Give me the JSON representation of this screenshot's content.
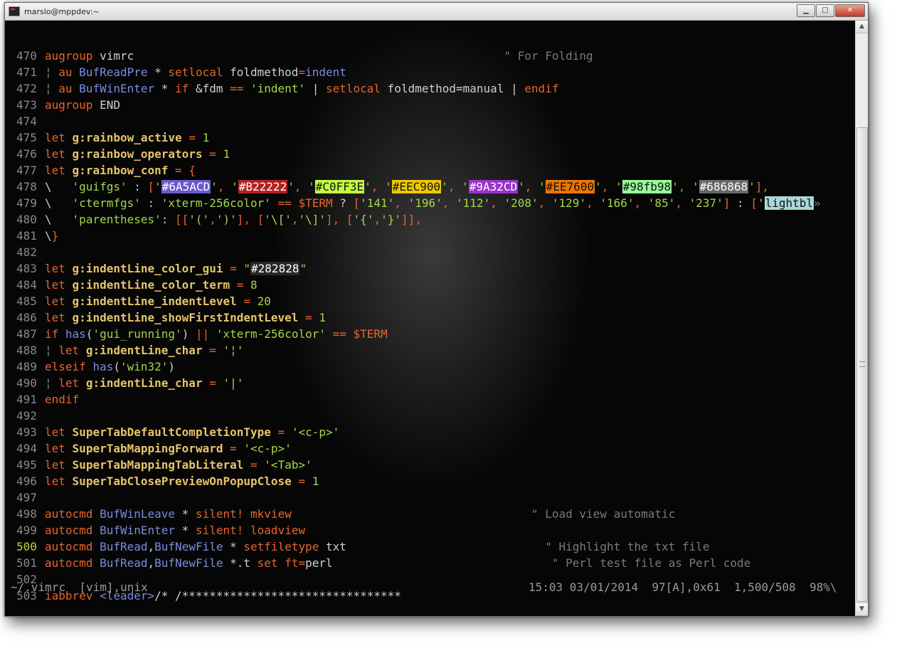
{
  "window": {
    "title": "marslo@mppdev:~"
  },
  "colors": {
    "keyword": "#e8642a",
    "function": "#7c8be0",
    "string": "#a5d64a",
    "variable": "#e6c46a",
    "comment": "#7a7a7a",
    "linenumber": "#8a8a8a",
    "current_linenumber": "#b8d63a"
  },
  "lines": [
    {
      "n": "470",
      "t": [
        [
          "kw",
          "augroup"
        ],
        [
          "id",
          " vimrc"
        ],
        [
          "id",
          "                                                      "
        ],
        [
          "cmt",
          "\" For Folding"
        ]
      ]
    },
    {
      "n": "471",
      "t": [
        [
          "pipe",
          "¦ "
        ],
        [
          "kw",
          "au"
        ],
        [
          "id",
          " "
        ],
        [
          "fn",
          "BufReadPre"
        ],
        [
          "id",
          " * "
        ],
        [
          "kw",
          "setlocal"
        ],
        [
          "id",
          " foldmethod"
        ],
        [
          "op",
          "="
        ],
        [
          "fn",
          "indent"
        ]
      ]
    },
    {
      "n": "472",
      "t": [
        [
          "pipe",
          "¦ "
        ],
        [
          "kw",
          "au"
        ],
        [
          "id",
          " "
        ],
        [
          "fn",
          "BufWinEnter"
        ],
        [
          "id",
          " * "
        ],
        [
          "kw",
          "if"
        ],
        [
          "id",
          " &fdm "
        ],
        [
          "op",
          "=="
        ],
        [
          "id",
          " "
        ],
        [
          "str",
          "'indent'"
        ],
        [
          "id",
          " | "
        ],
        [
          "kw",
          "setlocal"
        ],
        [
          "id",
          " foldmethod=manual | "
        ],
        [
          "kw",
          "endif"
        ]
      ]
    },
    {
      "n": "473",
      "t": [
        [
          "kw",
          "augroup"
        ],
        [
          "id",
          " END"
        ]
      ]
    },
    {
      "n": "474",
      "t": []
    },
    {
      "n": "475",
      "t": [
        [
          "kw",
          "let"
        ],
        [
          "id",
          " "
        ],
        [
          "var",
          "g:rainbow_active"
        ],
        [
          "id",
          " "
        ],
        [
          "op",
          "="
        ],
        [
          "id",
          " "
        ],
        [
          "num",
          "1"
        ]
      ]
    },
    {
      "n": "476",
      "t": [
        [
          "kw",
          "let"
        ],
        [
          "id",
          " "
        ],
        [
          "var",
          "g:rainbow_operators"
        ],
        [
          "id",
          " "
        ],
        [
          "op",
          "="
        ],
        [
          "id",
          " "
        ],
        [
          "num",
          "1"
        ]
      ]
    },
    {
      "n": "477",
      "t": [
        [
          "kw",
          "let"
        ],
        [
          "id",
          " "
        ],
        [
          "var",
          "g:rainbow_conf"
        ],
        [
          "id",
          " "
        ],
        [
          "op",
          "="
        ],
        [
          "id",
          " "
        ],
        [
          "kw",
          "{"
        ]
      ]
    },
    {
      "n": "478",
      "t": [
        [
          "id",
          "\\   "
        ],
        [
          "str",
          "'guifgs'"
        ],
        [
          "id",
          " : "
        ],
        [
          "kw",
          "["
        ],
        [
          "str",
          "'"
        ],
        [
          "chip:#6A5ACD",
          "#6A5ACD"
        ],
        [
          "str",
          "'"
        ],
        [
          "kw",
          ", "
        ],
        [
          "str",
          "'"
        ],
        [
          "chip:#B22222",
          "#B22222"
        ],
        [
          "str",
          "'"
        ],
        [
          "kw",
          ", "
        ],
        [
          "str",
          "'"
        ],
        [
          "chipd:#C0FF3E",
          "#C0FF3E"
        ],
        [
          "str",
          "'"
        ],
        [
          "kw",
          ", "
        ],
        [
          "str",
          "'"
        ],
        [
          "chipd:#EEC900",
          "#EEC900"
        ],
        [
          "str",
          "'"
        ],
        [
          "kw",
          ", "
        ],
        [
          "str",
          "'"
        ],
        [
          "chip:#9A32CD",
          "#9A32CD"
        ],
        [
          "str",
          "'"
        ],
        [
          "kw",
          ", "
        ],
        [
          "str",
          "'"
        ],
        [
          "chipd:#EE7600",
          "#EE7600"
        ],
        [
          "str",
          "'"
        ],
        [
          "kw",
          ", "
        ],
        [
          "str",
          "'"
        ],
        [
          "chipd:#98fb98",
          "#98fb98"
        ],
        [
          "str",
          "'"
        ],
        [
          "kw",
          ", "
        ],
        [
          "str",
          "'"
        ],
        [
          "chip:#686868",
          "#686868"
        ],
        [
          "str",
          "'"
        ],
        [
          "kw",
          "],"
        ]
      ]
    },
    {
      "n": "479",
      "t": [
        [
          "id",
          "\\   "
        ],
        [
          "str",
          "'ctermfgs'"
        ],
        [
          "id",
          " : "
        ],
        [
          "str",
          "'xterm-256color'"
        ],
        [
          "id",
          " "
        ],
        [
          "op",
          "=="
        ],
        [
          "id",
          " "
        ],
        [
          "env",
          "$TERM"
        ],
        [
          "id",
          " ? "
        ],
        [
          "kw",
          "["
        ],
        [
          "str",
          "'141'"
        ],
        [
          "kw",
          ", "
        ],
        [
          "str",
          "'196'"
        ],
        [
          "kw",
          ", "
        ],
        [
          "str",
          "'112'"
        ],
        [
          "kw",
          ", "
        ],
        [
          "str",
          "'208'"
        ],
        [
          "kw",
          ", "
        ],
        [
          "str",
          "'129'"
        ],
        [
          "kw",
          ", "
        ],
        [
          "str",
          "'166'"
        ],
        [
          "kw",
          ", "
        ],
        [
          "str",
          "'85'"
        ],
        [
          "kw",
          ", "
        ],
        [
          "str",
          "'237'"
        ],
        [
          "kw",
          "]"
        ],
        [
          "id",
          " : "
        ],
        [
          "kw",
          "["
        ],
        [
          "str",
          "'"
        ],
        [
          "chipd:#a8d8d8",
          "lightbl"
        ],
        [
          "cmt",
          "»"
        ]
      ]
    },
    {
      "n": "480",
      "t": [
        [
          "id",
          "\\   "
        ],
        [
          "str",
          "'parentheses'"
        ],
        [
          "id",
          ": "
        ],
        [
          "kw",
          "[["
        ],
        [
          "str",
          "'('"
        ],
        [
          "kw",
          ","
        ],
        [
          "str",
          "')'"
        ],
        [
          "kw",
          "]"
        ],
        [
          "kw",
          ", "
        ],
        [
          "kw",
          "["
        ],
        [
          "str",
          "'\\['"
        ],
        [
          "kw",
          ","
        ],
        [
          "str",
          "'\\]'"
        ],
        [
          "kw",
          "]"
        ],
        [
          "kw",
          ", "
        ],
        [
          "kw",
          "["
        ],
        [
          "str",
          "'{'"
        ],
        [
          "kw",
          ","
        ],
        [
          "str",
          "'}'"
        ],
        [
          "kw",
          "]]"
        ],
        [
          "kw",
          ","
        ]
      ]
    },
    {
      "n": "481",
      "t": [
        [
          "id",
          "\\"
        ],
        [
          "kw",
          "}"
        ]
      ]
    },
    {
      "n": "482",
      "t": []
    },
    {
      "n": "483",
      "t": [
        [
          "kw",
          "let"
        ],
        [
          "id",
          " "
        ],
        [
          "var",
          "g:indentLine_color_gui"
        ],
        [
          "id",
          " "
        ],
        [
          "op",
          "="
        ],
        [
          "id",
          " "
        ],
        [
          "str",
          "\""
        ],
        [
          "chip:#282828",
          "#282828"
        ],
        [
          "str",
          "\""
        ]
      ]
    },
    {
      "n": "484",
      "t": [
        [
          "kw",
          "let"
        ],
        [
          "id",
          " "
        ],
        [
          "var",
          "g:indentLine_color_term"
        ],
        [
          "id",
          " "
        ],
        [
          "op",
          "="
        ],
        [
          "id",
          " "
        ],
        [
          "num",
          "8"
        ]
      ]
    },
    {
      "n": "485",
      "t": [
        [
          "kw",
          "let"
        ],
        [
          "id",
          " "
        ],
        [
          "var",
          "g:indentLine_indentLevel"
        ],
        [
          "id",
          " "
        ],
        [
          "op",
          "="
        ],
        [
          "id",
          " "
        ],
        [
          "num",
          "20"
        ]
      ]
    },
    {
      "n": "486",
      "t": [
        [
          "kw",
          "let"
        ],
        [
          "id",
          " "
        ],
        [
          "var",
          "g:indentLine_showFirstIndentLevel"
        ],
        [
          "id",
          " "
        ],
        [
          "op",
          "="
        ],
        [
          "id",
          " "
        ],
        [
          "num",
          "1"
        ]
      ]
    },
    {
      "n": "487",
      "t": [
        [
          "kw",
          "if"
        ],
        [
          "id",
          " "
        ],
        [
          "fn",
          "has"
        ],
        [
          "id",
          "("
        ],
        [
          "str",
          "'gui_running'"
        ],
        [
          "id",
          ") "
        ],
        [
          "op",
          "||"
        ],
        [
          "id",
          " "
        ],
        [
          "str",
          "'xterm-256color'"
        ],
        [
          "id",
          " "
        ],
        [
          "op",
          "=="
        ],
        [
          "id",
          " "
        ],
        [
          "env",
          "$TERM"
        ]
      ]
    },
    {
      "n": "488",
      "t": [
        [
          "pipe",
          "¦ "
        ],
        [
          "kw",
          "let"
        ],
        [
          "id",
          " "
        ],
        [
          "var",
          "g:indentLine_char"
        ],
        [
          "id",
          " "
        ],
        [
          "op",
          "="
        ],
        [
          "id",
          " "
        ],
        [
          "str",
          "'¦'"
        ]
      ]
    },
    {
      "n": "489",
      "t": [
        [
          "kw",
          "elseif"
        ],
        [
          "id",
          " "
        ],
        [
          "fn",
          "has"
        ],
        [
          "id",
          "("
        ],
        [
          "str",
          "'win32'"
        ],
        [
          "id",
          ")"
        ]
      ]
    },
    {
      "n": "490",
      "t": [
        [
          "pipe",
          "¦ "
        ],
        [
          "kw",
          "let"
        ],
        [
          "id",
          " "
        ],
        [
          "var",
          "g:indentLine_char"
        ],
        [
          "id",
          " "
        ],
        [
          "op",
          "="
        ],
        [
          "id",
          " "
        ],
        [
          "str",
          "'|'"
        ]
      ]
    },
    {
      "n": "491",
      "t": [
        [
          "kw",
          "endif"
        ]
      ]
    },
    {
      "n": "492",
      "t": []
    },
    {
      "n": "493",
      "t": [
        [
          "kw",
          "let"
        ],
        [
          "id",
          " "
        ],
        [
          "var",
          "SuperTabDefaultCompletionType"
        ],
        [
          "id",
          " "
        ],
        [
          "op",
          "="
        ],
        [
          "id",
          " "
        ],
        [
          "str",
          "'<c-p>'"
        ]
      ]
    },
    {
      "n": "494",
      "t": [
        [
          "kw",
          "let"
        ],
        [
          "id",
          " "
        ],
        [
          "var",
          "SuperTabMappingForward"
        ],
        [
          "id",
          " "
        ],
        [
          "op",
          "="
        ],
        [
          "id",
          " "
        ],
        [
          "str",
          "'<c-p>'"
        ]
      ]
    },
    {
      "n": "495",
      "t": [
        [
          "kw",
          "let"
        ],
        [
          "id",
          " "
        ],
        [
          "var",
          "SuperTabMappingTabLiteral"
        ],
        [
          "id",
          " "
        ],
        [
          "op",
          "="
        ],
        [
          "id",
          " "
        ],
        [
          "str",
          "'<Tab>'"
        ]
      ]
    },
    {
      "n": "496",
      "t": [
        [
          "kw",
          "let"
        ],
        [
          "id",
          " "
        ],
        [
          "var",
          "SuperTabClosePreviewOnPopupClose"
        ],
        [
          "id",
          " "
        ],
        [
          "op",
          "="
        ],
        [
          "id",
          " "
        ],
        [
          "num",
          "1"
        ]
      ]
    },
    {
      "n": "497",
      "t": []
    },
    {
      "n": "498",
      "t": [
        [
          "kw",
          "autocmd"
        ],
        [
          "id",
          " "
        ],
        [
          "fn",
          "BufWinLeave"
        ],
        [
          "id",
          " * "
        ],
        [
          "kw",
          "silent!"
        ],
        [
          "id",
          " "
        ],
        [
          "kw",
          "mkview"
        ],
        [
          "id",
          "                                   "
        ],
        [
          "cmt",
          "\" Load view automatic"
        ]
      ]
    },
    {
      "n": "499",
      "t": [
        [
          "kw",
          "autocmd"
        ],
        [
          "id",
          " "
        ],
        [
          "fn",
          "BufWinEnter"
        ],
        [
          "id",
          " * "
        ],
        [
          "kw",
          "silent!"
        ],
        [
          "id",
          " "
        ],
        [
          "kw",
          "loadview"
        ]
      ]
    },
    {
      "n": "500",
      "cur": true,
      "t": [
        [
          "kw",
          "autocmd"
        ],
        [
          "id",
          " "
        ],
        [
          "fn",
          "BufRead"
        ],
        [
          "id",
          ","
        ],
        [
          "fn",
          "BufNewFile"
        ],
        [
          "id",
          " * "
        ],
        [
          "kw",
          "setfiletype"
        ],
        [
          "id",
          " txt"
        ],
        [
          "id",
          "                             "
        ],
        [
          "cmt",
          "\" Highlight the txt file"
        ]
      ]
    },
    {
      "n": "501",
      "t": [
        [
          "kw",
          "autocmd"
        ],
        [
          "id",
          " "
        ],
        [
          "fn",
          "BufRead"
        ],
        [
          "id",
          ","
        ],
        [
          "fn",
          "BufNewFile"
        ],
        [
          "id",
          " *.t "
        ],
        [
          "kw",
          "set"
        ],
        [
          "id",
          " "
        ],
        [
          "kw",
          "ft"
        ],
        [
          "op",
          "="
        ],
        [
          "id",
          "perl"
        ],
        [
          "id",
          "                                "
        ],
        [
          "cmt",
          "\" Perl test file as Perl code"
        ]
      ]
    },
    {
      "n": "502",
      "t": []
    },
    {
      "n": "503",
      "t": [
        [
          "kw",
          "iabbrev"
        ],
        [
          "id",
          " "
        ],
        [
          "fn",
          "<leader>"
        ],
        [
          "id",
          "/* /********************************"
        ]
      ]
    }
  ],
  "statusline": {
    "left": "~/.vimrc  [vim],unix",
    "right": "15:03 03/01/2014  97[A],0x61  1,500/508  98%\\"
  },
  "scrollbar": {
    "up": "▲",
    "down": "▼",
    "position_percent": 98
  },
  "window_buttons": {
    "minimize": "▁",
    "maximize": "□",
    "close": "✕"
  }
}
